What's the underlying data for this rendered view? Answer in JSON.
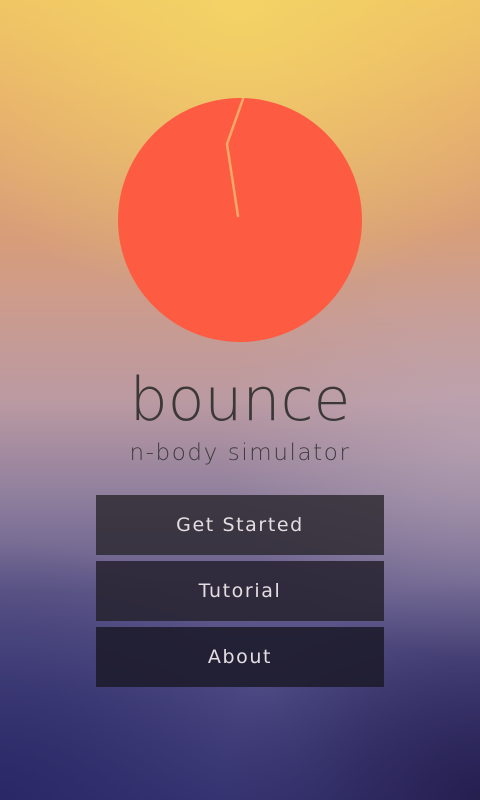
{
  "app": {
    "title": "bounce",
    "subtitle": "n-body simulator"
  },
  "logo": {
    "icon": "bouncing-ball-logo-icon",
    "colors": {
      "ball": "#fd5c42",
      "trail": "#f4a86a"
    }
  },
  "menu": {
    "buttons": [
      {
        "label": "Get Started"
      },
      {
        "label": "Tutorial"
      },
      {
        "label": "About"
      }
    ]
  },
  "theme": {
    "text_dark": "#3c3838",
    "button_text": "#e4dde2",
    "button_bg": "#2c2830"
  }
}
